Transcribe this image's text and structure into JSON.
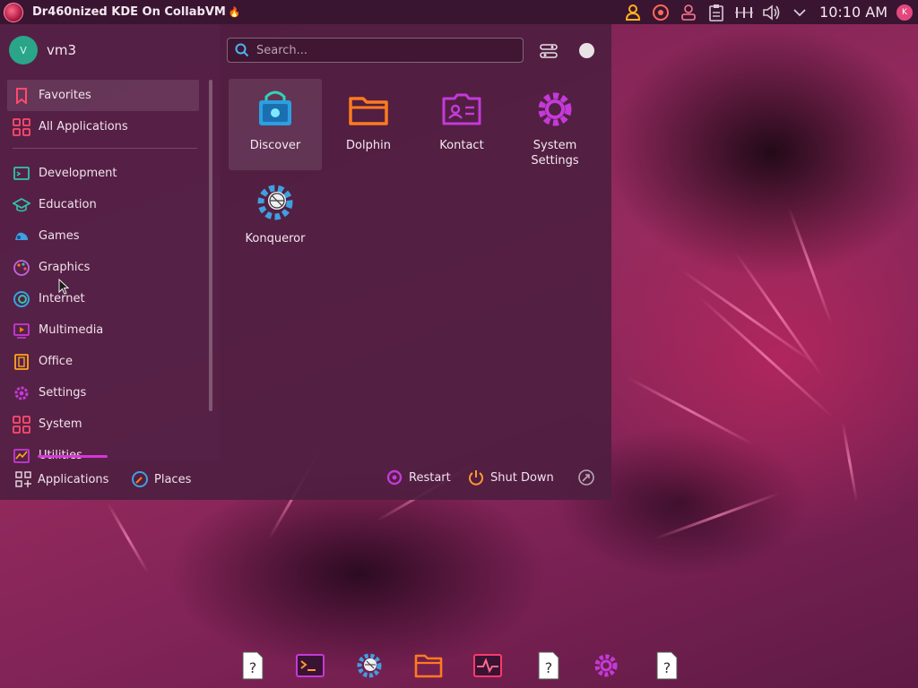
{
  "top_panel": {
    "window_title": "Dr460nized KDE On CollabVM",
    "title_emoji": "🔥",
    "tray_icons": [
      "user-icon",
      "updates-icon",
      "accounts-icon",
      "clipboard-icon",
      "audio-mixer-icon",
      "volume-icon",
      "expand-tray-icon"
    ],
    "clock": "10:10 AM",
    "user_badge": "K"
  },
  "launcher": {
    "user": {
      "avatar_letter": "V",
      "name": "vm3"
    },
    "search": {
      "placeholder": "Search..."
    },
    "categories": [
      {
        "label": "Favorites",
        "icon": "bookmark-icon",
        "active": true
      },
      {
        "label": "All Applications",
        "icon": "grid-icon"
      },
      {
        "label": "Development",
        "icon": "development-icon"
      },
      {
        "label": "Education",
        "icon": "education-icon"
      },
      {
        "label": "Games",
        "icon": "games-icon"
      },
      {
        "label": "Graphics",
        "icon": "graphics-icon"
      },
      {
        "label": "Internet",
        "icon": "internet-icon"
      },
      {
        "label": "Multimedia",
        "icon": "multimedia-icon"
      },
      {
        "label": "Office",
        "icon": "office-icon"
      },
      {
        "label": "Settings",
        "icon": "settings-icon"
      },
      {
        "label": "System",
        "icon": "system-icon"
      },
      {
        "label": "Utilities",
        "icon": "utilities-icon"
      }
    ],
    "apps": [
      {
        "label": "Discover",
        "icon": "discover-icon"
      },
      {
        "label": "Dolphin",
        "icon": "dolphin-icon"
      },
      {
        "label": "Kontact",
        "icon": "kontact-icon"
      },
      {
        "label": "System Settings",
        "icon": "system-settings-icon"
      },
      {
        "label": "Konqueror",
        "icon": "konqueror-icon"
      }
    ],
    "bottom": {
      "applications": "Applications",
      "places": "Places",
      "restart": "Restart",
      "shutdown": "Shut Down"
    }
  },
  "dock": {
    "icons": [
      "unknown-app-icon",
      "terminal-icon",
      "konqueror-icon",
      "file-manager-icon",
      "system-monitor-icon",
      "unknown-app-icon",
      "system-settings-icon",
      "unknown-app-icon"
    ]
  },
  "colors": {
    "accent_pink": "#e2487e",
    "accent_purple": "#c43ad8",
    "accent_orange": "#ff7a1e",
    "accent_teal": "#2aa58a",
    "panel_bg": "#3a1532"
  }
}
